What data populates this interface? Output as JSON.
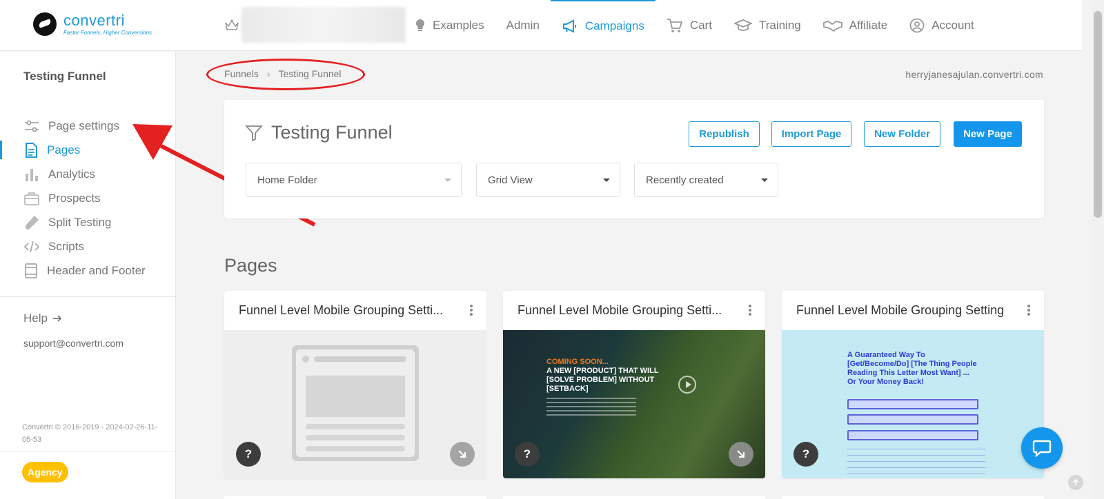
{
  "brand": {
    "name": "convertri",
    "tagline": "Faster Funnels, Higher Conversions"
  },
  "nav": [
    {
      "label": "Examples",
      "icon": "lightbulb-icon"
    },
    {
      "label": "Admin",
      "icon": ""
    },
    {
      "label": "Campaigns",
      "icon": "megaphone-icon",
      "active": true
    },
    {
      "label": "Cart",
      "icon": "cart-icon"
    },
    {
      "label": "Training",
      "icon": "graduation-cap-icon"
    },
    {
      "label": "Affiliate",
      "icon": "handshake-icon"
    },
    {
      "label": "Account",
      "icon": "user-circle-icon"
    }
  ],
  "sidebar": {
    "title": "Testing Funnel",
    "items": [
      {
        "label": "Page settings",
        "icon": "sliders-icon"
      },
      {
        "label": "Pages",
        "icon": "document-icon",
        "active": true
      },
      {
        "label": "Analytics",
        "icon": "bar-chart-icon"
      },
      {
        "label": "Prospects",
        "icon": "briefcase-icon"
      },
      {
        "label": "Split Testing",
        "icon": "test-tube-icon"
      },
      {
        "label": "Scripts",
        "icon": "code-icon"
      },
      {
        "label": "Header and Footer",
        "icon": "layout-icon"
      }
    ],
    "help": "Help",
    "support_email": "support@convertri.com",
    "copyright": "Convertri © 2016-2019 - 2024-02-26-11-05-53",
    "plan_badge": "Agency"
  },
  "breadcrumb": {
    "root": "Funnels",
    "current": "Testing Funnel"
  },
  "domain": "herryjanesajulan.convertri.com",
  "funnel": {
    "title": "Testing Funnel",
    "buttons": {
      "republish": "Republish",
      "import": "Import Page",
      "new_folder": "New Folder",
      "new_page": "New Page"
    },
    "folder_select": "Home Folder",
    "view_select": "Grid View",
    "sort_select": "Recently created"
  },
  "pages_heading": "Pages",
  "pages": [
    {
      "name": "Funnel Level Mobile Grouping Setti...",
      "thumbnail": "placeholder"
    },
    {
      "name": "Funnel Level Mobile Grouping Setti...",
      "thumbnail": "coming-soon",
      "thumb_text": {
        "line1": "COMING SOON...",
        "line2": "A NEW [PRODUCT] THAT WILL [SOLVE PROBLEM] WITHOUT [SETBACK]"
      }
    },
    {
      "name": "Funnel Level Mobile Grouping Setting",
      "thumbnail": "sales-letter",
      "thumb_text": {
        "headline": "A Guaranteed Way To [Get/Become/Do] [The Thing People Reading This Letter Most Want] ... Or Your Money Back!"
      }
    }
  ],
  "colors": {
    "accent": "#1e9ad6",
    "primary_button": "#1396ec",
    "annotation": "#e32121",
    "badge": "#ffc000"
  }
}
